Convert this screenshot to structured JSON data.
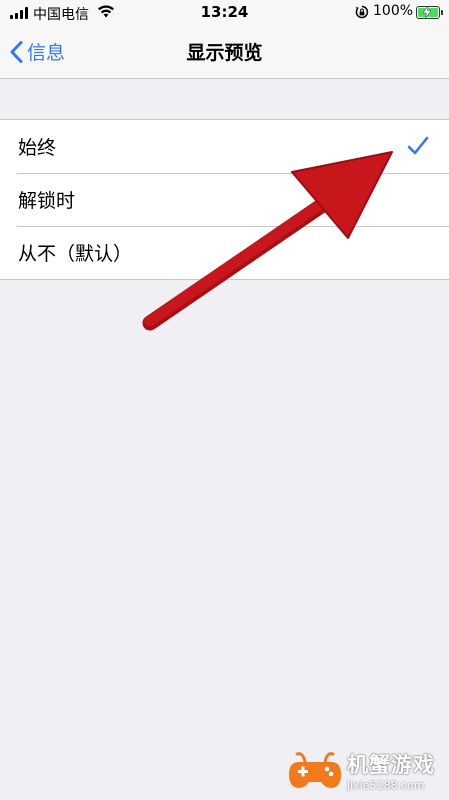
{
  "status_bar": {
    "carrier": "中国电信",
    "time": "13:24",
    "battery_percent": "100%",
    "signal_icon": "signal-bars-icon",
    "wifi_icon": "wifi-icon",
    "orientation_lock_icon": "orientation-lock-icon",
    "battery_icon": "battery-charging-icon"
  },
  "nav": {
    "back_label": "信息",
    "title": "显示预览"
  },
  "options": [
    {
      "label": "始终",
      "selected": true
    },
    {
      "label": "解锁时",
      "selected": false
    },
    {
      "label": "从不（默认）",
      "selected": false
    }
  ],
  "colors": {
    "accent": "#3478f6",
    "background": "#efeff4",
    "annotation_arrow": "#c0141b",
    "battery_fill": "#4cd964"
  },
  "watermark": {
    "name": "机蟹游戏",
    "url": "jixie5188.com"
  }
}
